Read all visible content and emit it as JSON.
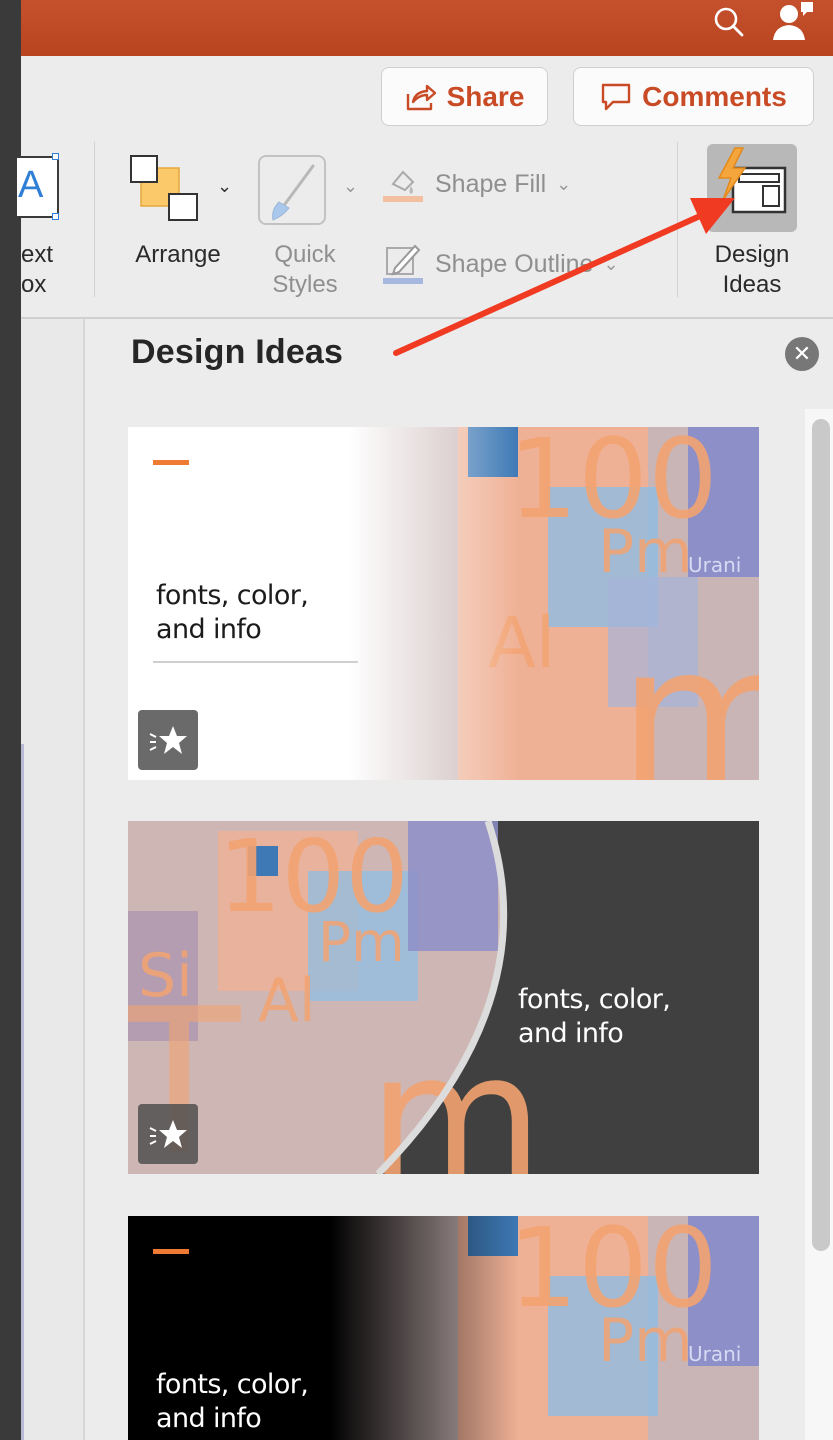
{
  "header": {
    "search_icon": "search-icon",
    "account_icon": "person-icon"
  },
  "sharebar": {
    "share_label": "Share",
    "comments_label": "Comments"
  },
  "ribbon": {
    "textbox_label_1": "ext",
    "textbox_label_2": "ox",
    "arrange_label": "Arrange",
    "quick_styles_label_1": "Quick",
    "quick_styles_label_2": "Styles",
    "shape_fill_label": "Shape Fill",
    "shape_outline_label": "Shape Outline",
    "design_ideas_label_1": "Design",
    "design_ideas_label_2": "Ideas"
  },
  "panel": {
    "title": "Design Ideas",
    "thumbnails": [
      {
        "line1": "fonts, color,",
        "line2": "and info"
      },
      {
        "line1": "fonts, color,",
        "line2": "and info"
      },
      {
        "line1": "fonts, color,",
        "line2": "and info"
      }
    ]
  },
  "colors": {
    "titlebar": "#c5502d",
    "accent": "#c84b26",
    "arrow": "#f03a22",
    "slide_orange": "#ef7a33"
  }
}
